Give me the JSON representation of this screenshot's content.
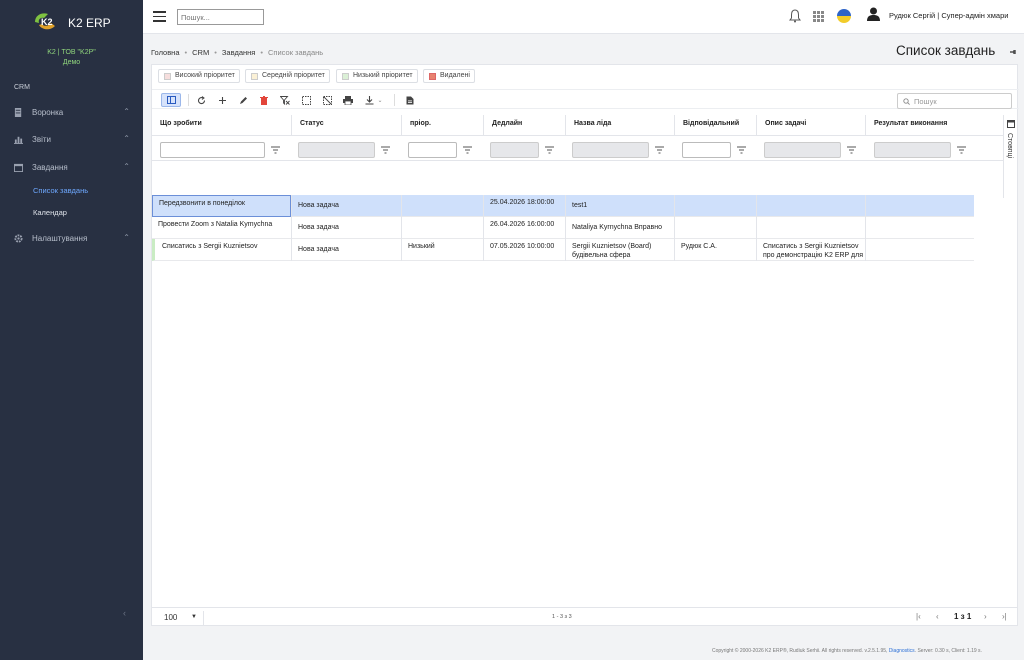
{
  "app": {
    "logo_text": "K2 ERP",
    "company": "K2 | ТОВ \"K2P\"",
    "company_sub": "Демо"
  },
  "sidebar": {
    "section_label": "CRM",
    "items": [
      {
        "label": "Воронка",
        "icon": "funnel-icon"
      },
      {
        "label": "Звіти",
        "icon": "chart-icon"
      },
      {
        "label": "Завдання",
        "icon": "calendar-icon"
      },
      {
        "label": "Налаштування",
        "icon": "gear-icon"
      }
    ],
    "sub_items": [
      {
        "label": "Список завдань",
        "active": true
      },
      {
        "label": "Календар",
        "active": false
      }
    ]
  },
  "topbar": {
    "search_placeholder": "Пошук...",
    "user_name": "Рудюк Сергій | Супер-адмін хмари"
  },
  "breadcrumb": {
    "items": [
      "Головна",
      "CRM",
      "Завдання"
    ],
    "current": "Список завдань"
  },
  "page": {
    "title": "Список завдань"
  },
  "legend": [
    {
      "label": "Високий пріоритет",
      "color": "#f6dedd"
    },
    {
      "label": "Середній пріоритет",
      "color": "#fbf1d6"
    },
    {
      "label": "Низький пріоритет",
      "color": "#dbf0d6"
    },
    {
      "label": "Видалені",
      "color": "#e8826f"
    }
  ],
  "grid_search_placeholder": "Пошук",
  "columns_label": "Стовпці",
  "columns": [
    "Що зробити",
    "Статус",
    "пріор.",
    "Дедлайн",
    "Назва ліда",
    "Відповідальний",
    "Опис задачі",
    "Результат виконання"
  ],
  "rows": [
    {
      "todo": "Передзвонити в понеділок",
      "status": "Нова задача",
      "priority": "",
      "deadline": "25.04.2026 18:00:00",
      "lead": "test1",
      "responsible": "",
      "description": "",
      "result": ""
    },
    {
      "todo": "Провести Zoom з Natalia Kymychna",
      "status": "Нова задача",
      "priority": "",
      "deadline": "26.04.2026 16:00:00",
      "lead": "Nataliya Kyrnychna Вправно",
      "responsible": "",
      "description": "",
      "result": ""
    },
    {
      "todo": "Списатись з Sergii Kuznietsov",
      "status": "Нова задача",
      "priority": "Низький",
      "deadline": "07.05.2026 10:00:00",
      "lead": "Sergii Kuznietsov (Board) будівельна сфера",
      "responsible": "Рудюк С.А.",
      "description": "Списатись з Sergii Kuznietsov про демонстрацію K2 ERP для",
      "result": ""
    }
  ],
  "footer": {
    "page_size": "100",
    "range": "1 - 3 з 3",
    "page_info": "1 з 1"
  },
  "copyright": {
    "text": "Copyright © 2000-2026 K2 ERP®, Rudiuk Serhii. All rights reserved. v.2.5.1.95,",
    "diagnostics": "Diagnostics",
    "server": ". Server: 0.30 s, Client: 1.19 s."
  }
}
